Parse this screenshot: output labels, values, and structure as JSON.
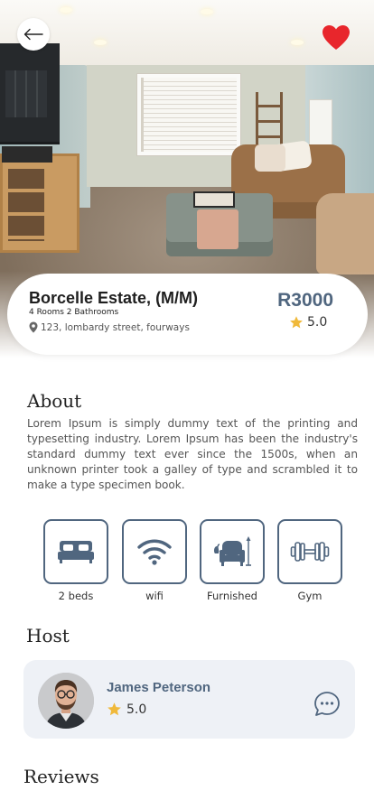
{
  "colors": {
    "accent": "#50667f",
    "star": "#f0b93a",
    "heart": "#e8262c",
    "host_card_bg": "#eef1f6"
  },
  "header": {
    "back_icon": "arrow-left-icon",
    "favorite_icon": "heart-icon"
  },
  "listing": {
    "title": "Borcelle Estate, (M/M)",
    "rooms": "4 Rooms 2 Bathrooms",
    "address": "123, lombardy street, fourways",
    "price": "R3000",
    "rating": "5.0"
  },
  "about": {
    "heading": "About",
    "text": "Lorem Ipsum is simply dummy text of the printing and typesetting industry. Lorem Ipsum has been the industry's standard dummy text ever since the 1500s, when an unknown printer took a galley of type and scrambled it to make a type specimen book."
  },
  "amenities": [
    {
      "label": "2 beds",
      "icon": "bed-icon"
    },
    {
      "label": "wifi",
      "icon": "wifi-icon"
    },
    {
      "label": "Furnished",
      "icon": "armchair-icon"
    },
    {
      "label": "Gym",
      "icon": "dumbbell-icon"
    }
  ],
  "host": {
    "heading": "Host",
    "name": "James Peterson",
    "rating": "5.0",
    "chat_icon": "chat-icon"
  },
  "reviews": {
    "heading": "Reviews"
  }
}
